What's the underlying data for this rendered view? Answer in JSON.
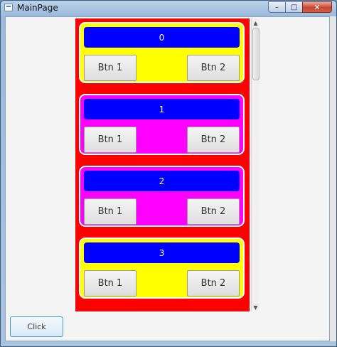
{
  "window": {
    "title": "MainPage",
    "controls": {
      "minimize": "–",
      "maximize": "□",
      "close": "✕"
    }
  },
  "colors": {
    "listBackground": "#ff0000",
    "headerBackground": "#0000ff",
    "itemYellow": "#ffff00",
    "itemMagenta": "#ff00ff"
  },
  "list": {
    "items": [
      {
        "header": "0",
        "btn1": "Btn 1",
        "btn2": "Btn 2",
        "color": "#ffff00"
      },
      {
        "header": "1",
        "btn1": "Btn 1",
        "btn2": "Btn 2",
        "color": "#ff00ff"
      },
      {
        "header": "2",
        "btn1": "Btn 1",
        "btn2": "Btn 2",
        "color": "#ff00ff"
      },
      {
        "header": "3",
        "btn1": "Btn 1",
        "btn2": "Btn 2",
        "color": "#ffff00"
      }
    ]
  },
  "footer": {
    "click_label": "Click"
  }
}
